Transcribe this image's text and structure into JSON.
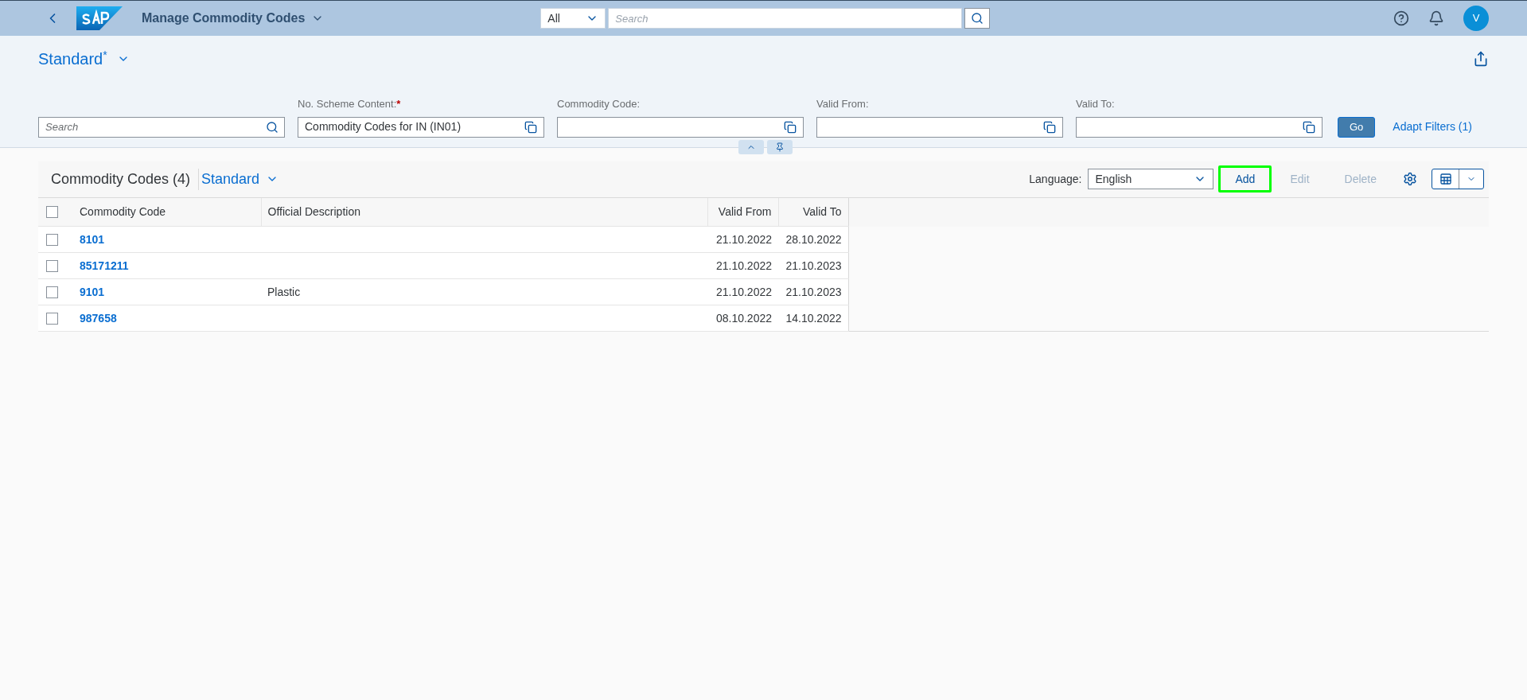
{
  "shell": {
    "app_title": "Manage Commodity Codes",
    "scope": "All",
    "search_placeholder": "Search",
    "avatar": "V"
  },
  "variant": {
    "name": "Standard",
    "modified_mark": "*"
  },
  "filters": {
    "search_placeholder": "Search",
    "fields": [
      {
        "label": "No. Scheme Content:",
        "required": true,
        "value": "Commodity Codes for IN (IN01)"
      },
      {
        "label": "Commodity Code:",
        "required": false
      },
      {
        "label": "Valid From:",
        "required": false
      },
      {
        "label": "Valid To:",
        "required": false
      }
    ],
    "go": "Go",
    "adapt": "Adapt Filters (1)"
  },
  "table": {
    "title": "Commodity Codes (4)",
    "variant": "Standard",
    "language_label": "Language:",
    "language": "English",
    "actions": [
      {
        "label": "Add",
        "disabled": false,
        "highlighted": true
      },
      {
        "label": "Edit",
        "disabled": true,
        "highlighted": false
      },
      {
        "label": "Delete",
        "disabled": true,
        "highlighted": false
      }
    ],
    "select_all_checked": false,
    "columns": [
      "Commodity Code",
      "Official Description",
      "Valid From",
      "Valid To"
    ],
    "rows": [
      {
        "code": "8101",
        "valid_from": "21.10.2022",
        "valid_to": "28.10.2022",
        "checked": false
      },
      {
        "code": "85171211",
        "valid_from": "21.10.2022",
        "valid_to": "21.10.2023",
        "checked": false
      },
      {
        "code": "9101",
        "description": "Plastic",
        "valid_from": "21.10.2022",
        "valid_to": "21.10.2023",
        "checked": false
      },
      {
        "code": "987658",
        "valid_from": "08.10.2022",
        "valid_to": "14.10.2022",
        "checked": false
      }
    ]
  }
}
